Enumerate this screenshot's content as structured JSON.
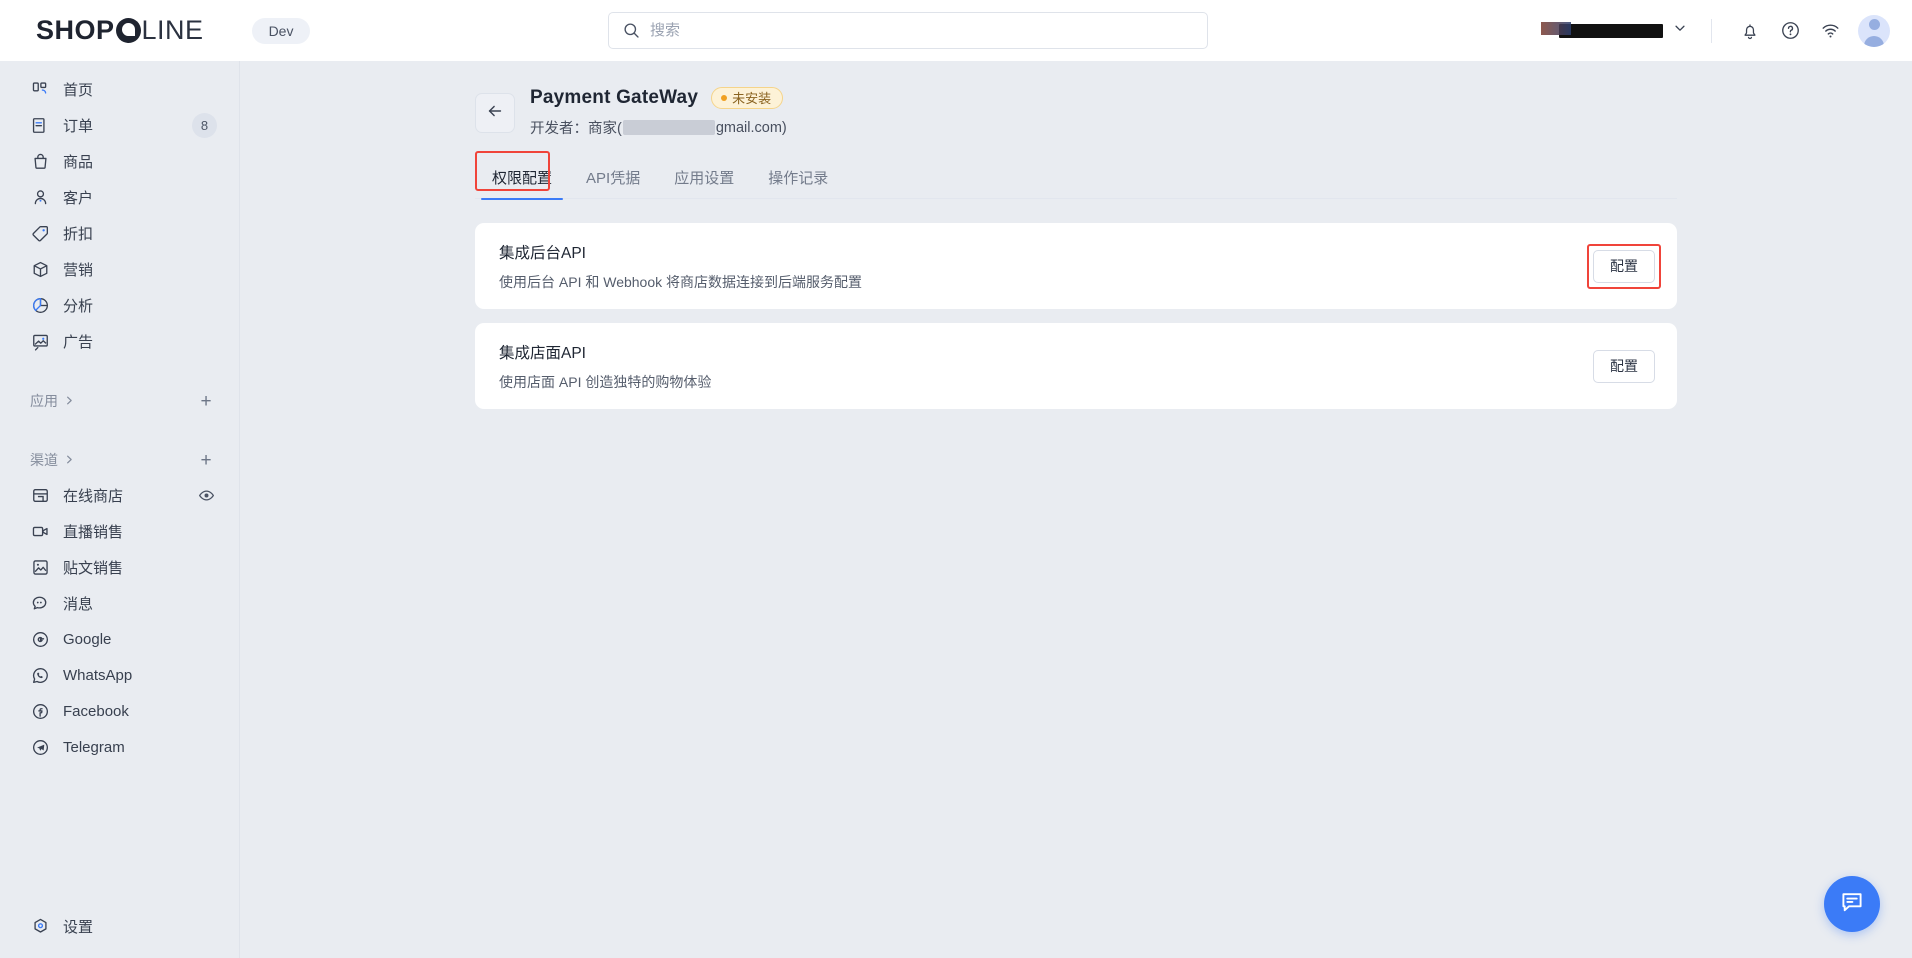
{
  "brand": {
    "logo_bold": "SHOP",
    "logo_light": "LINE",
    "dev_pill": "Dev",
    "accent": "#3b7bf7"
  },
  "search": {
    "placeholder": "搜索",
    "value": "",
    "icon": "search-icon"
  },
  "topbar": {
    "store_name": "",
    "icons": [
      "bell-icon",
      "help-circle-icon",
      "wifi-icon",
      "avatar"
    ]
  },
  "sidebar": {
    "items": [
      {
        "label": "首页",
        "icon": "home-icon"
      },
      {
        "label": "订单",
        "icon": "orders-icon",
        "badge": "8"
      },
      {
        "label": "商品",
        "icon": "products-bag-icon"
      },
      {
        "label": "客户",
        "icon": "customer-person-icon"
      },
      {
        "label": "折扣",
        "icon": "discount-tag-icon"
      },
      {
        "label": "营销",
        "icon": "marketing-cube-icon"
      },
      {
        "label": "分析",
        "icon": "analytics-pie-icon"
      },
      {
        "label": "广告",
        "icon": "ads-image-icon"
      }
    ],
    "sections": [
      {
        "label": "应用",
        "icon": "chevron-right-icon",
        "add": "+"
      },
      {
        "label": "渠道",
        "icon": "chevron-right-icon",
        "add": "+"
      }
    ],
    "channels": [
      {
        "label": "在线商店",
        "icon": "online-store-icon",
        "trailing": "eye-icon"
      },
      {
        "label": "直播销售",
        "icon": "live-video-icon"
      },
      {
        "label": "贴文销售",
        "icon": "post-image-icon"
      },
      {
        "label": "消息",
        "icon": "message-icon"
      },
      {
        "label": "Google",
        "icon": "google-icon"
      },
      {
        "label": "WhatsApp",
        "icon": "whatsapp-icon"
      },
      {
        "label": "Facebook",
        "icon": "facebook-icon"
      },
      {
        "label": "Telegram",
        "icon": "telegram-icon"
      }
    ],
    "settings": {
      "label": "设置",
      "icon": "gear-icon"
    }
  },
  "page": {
    "back_icon": "back-arrow-icon",
    "title": "Payment GateWay",
    "status_badge": "未安装",
    "status_color": "#f0a020",
    "developer_prefix": "开发者：商家(",
    "developer_suffix": "gmail.com)"
  },
  "tabs": [
    {
      "label": "权限配置",
      "active": true
    },
    {
      "label": "API凭据",
      "active": false
    },
    {
      "label": "应用设置",
      "active": false
    },
    {
      "label": "操作记录",
      "active": false
    }
  ],
  "cards": [
    {
      "title": "集成后台API",
      "desc": "使用后台 API 和 Webhook 将商店数据连接到后端服务配置",
      "button": "配置",
      "highlighted": true
    },
    {
      "title": "集成店面API",
      "desc": "使用店面 API 创造独特的购物体验",
      "button": "配置",
      "highlighted": false
    }
  ],
  "fab": {
    "icon": "chat-bubble-icon"
  }
}
